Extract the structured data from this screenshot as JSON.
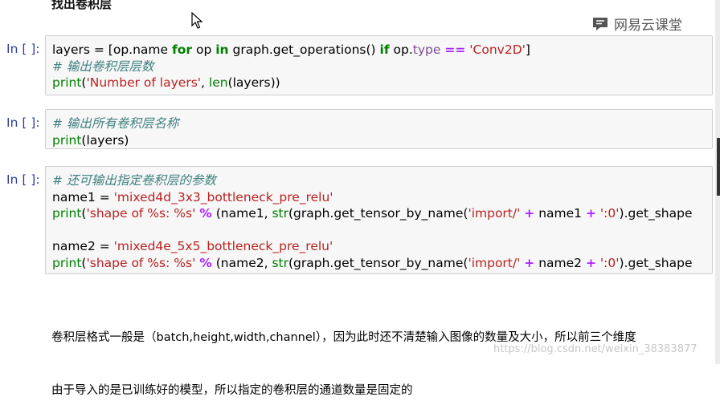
{
  "heading": "找出卷积层",
  "logo": {
    "text": "网易云课堂",
    "icon": "cloud-classroom-icon"
  },
  "cells": [
    {
      "prompt": "In [ ]:",
      "lines": [
        [
          [
            "t",
            "layers = [op.name "
          ],
          [
            "kw",
            "for"
          ],
          [
            "t",
            " op "
          ],
          [
            "kw",
            "in"
          ],
          [
            "t",
            " graph.get_operations() "
          ],
          [
            "kw",
            "if"
          ],
          [
            "t",
            " op."
          ],
          [
            "attr",
            "type"
          ],
          [
            "t",
            " "
          ],
          [
            "op",
            "=="
          ],
          [
            "t",
            " "
          ],
          [
            "str",
            "'Conv2D'"
          ],
          [
            "t",
            "]"
          ]
        ],
        [
          [
            "cm",
            "# 输出卷积层层数"
          ]
        ],
        [
          [
            "bi",
            "print"
          ],
          [
            "t",
            "("
          ],
          [
            "str",
            "'Number of layers'"
          ],
          [
            "t",
            ", "
          ],
          [
            "bi",
            "len"
          ],
          [
            "t",
            "(layers))"
          ]
        ]
      ]
    },
    {
      "prompt": "In [ ]:",
      "lines": [
        [
          [
            "cm",
            "# 输出所有卷积层名称"
          ]
        ],
        [
          [
            "bi",
            "print"
          ],
          [
            "t",
            "(layers)"
          ]
        ]
      ]
    },
    {
      "prompt": "In [ ]:",
      "lines": [
        [
          [
            "cm",
            "# 还可输出指定卷积层的参数"
          ]
        ],
        [
          [
            "t",
            "name1 = "
          ],
          [
            "str",
            "'mixed4d_3x3_bottleneck_pre_relu'"
          ]
        ],
        [
          [
            "bi",
            "print"
          ],
          [
            "t",
            "("
          ],
          [
            "str",
            "'shape of %s: %s'"
          ],
          [
            "t",
            " "
          ],
          [
            "op",
            "%"
          ],
          [
            "t",
            " (name1, "
          ],
          [
            "bi",
            "str"
          ],
          [
            "t",
            "(graph.get_tensor_by_name("
          ],
          [
            "str",
            "'import/'"
          ],
          [
            "t",
            " "
          ],
          [
            "op",
            "+"
          ],
          [
            "t",
            " name1 "
          ],
          [
            "op",
            "+"
          ],
          [
            "t",
            " "
          ],
          [
            "str",
            "':0'"
          ],
          [
            "t",
            ").get_shape"
          ]
        ],
        [
          [
            "t",
            ""
          ]
        ],
        [
          [
            "t",
            "name2 = "
          ],
          [
            "str",
            "'mixed4e_5x5_bottleneck_pre_relu'"
          ]
        ],
        [
          [
            "bi",
            "print"
          ],
          [
            "t",
            "("
          ],
          [
            "str",
            "'shape of %s: %s'"
          ],
          [
            "t",
            " "
          ],
          [
            "op",
            "%"
          ],
          [
            "t",
            " (name2, "
          ],
          [
            "bi",
            "str"
          ],
          [
            "t",
            "(graph.get_tensor_by_name("
          ],
          [
            "str",
            "'import/'"
          ],
          [
            "t",
            " "
          ],
          [
            "op",
            "+"
          ],
          [
            "t",
            " name2 "
          ],
          [
            "op",
            "+"
          ],
          [
            "t",
            " "
          ],
          [
            "str",
            "':0'"
          ],
          [
            "t",
            ").get_shape"
          ]
        ]
      ]
    }
  ],
  "markdown": {
    "line1": "卷积层格式一般是（batch,height,width,channel），因为此时还不清楚输入图像的数量及大小，所以前三个维度",
    "line2": "由于导入的是已训练好的模型，所以指定的卷积层的通道数量是固定的"
  },
  "watermark": "https://blog.csdn.net/weixin_38383877"
}
